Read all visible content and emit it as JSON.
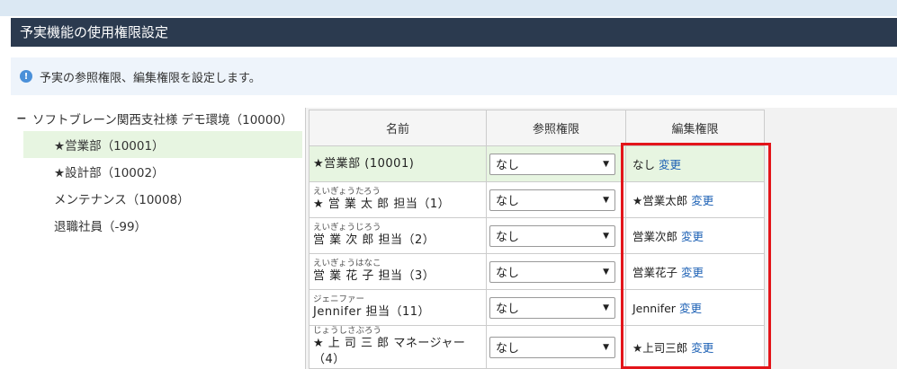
{
  "title": "予実機能の使用権限設定",
  "info": {
    "icon": "info-icon",
    "text": "予実の参照権限、編集権限を設定します。"
  },
  "tree": {
    "root_label": "ソフトブレーン関西支社様 デモ環境（10000）",
    "collapse_symbol": "−",
    "items": [
      {
        "label": "★営業部（10001）",
        "selected": true
      },
      {
        "label": "★設計部（10002）",
        "selected": false
      },
      {
        "label": "メンテナンス（10008）",
        "selected": false
      },
      {
        "label": "退職社員（-99）",
        "selected": false
      }
    ]
  },
  "table": {
    "headers": {
      "name": "名前",
      "view": "参照権限",
      "edit": "編集権限"
    },
    "change_label": "変更",
    "rows": [
      {
        "ruby": "",
        "name": "★営業部 (10001)",
        "view": "なし",
        "edit": "なし"
      },
      {
        "ruby": "えいぎょうたろう",
        "name": "★ 営 業 太 郎 担当（1）",
        "view": "なし",
        "edit": "★営業太郎"
      },
      {
        "ruby": "えいぎょうじろう",
        "name": " 営 業 次 郎 担当（2）",
        "view": "なし",
        "edit": "営業次郎"
      },
      {
        "ruby": "えいぎょうはなこ",
        "name": " 営 業 花 子 担当（3）",
        "view": "なし",
        "edit": "営業花子"
      },
      {
        "ruby": "ジェニファー",
        "name": " Jennifer 担当（11）",
        "view": "なし",
        "edit": "Jennifer"
      },
      {
        "ruby": "じょうしさぶろう",
        "name": "★ 上 司 三 郎 マネージャー（4）",
        "view": "なし",
        "edit": "★上司三郎"
      }
    ]
  },
  "colors": {
    "title_bar": "#2b3a4f",
    "selected_bg": "#e7f5e1",
    "link": "#1a5fb4",
    "highlight_frame": "#e3151a"
  }
}
